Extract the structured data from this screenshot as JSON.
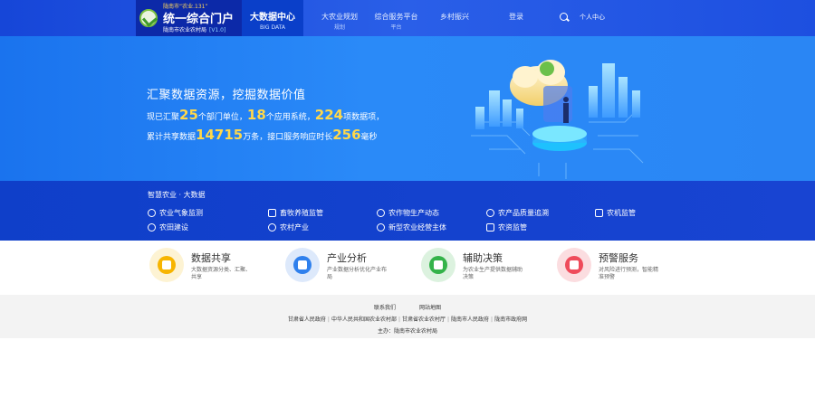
{
  "header": {
    "brand_top": "陇南市“农业.131”",
    "brand_title": "统一综合门户",
    "brand_sub": "陇南市农业农村局",
    "brand_ver": "[V1.0]",
    "active_nav": {
      "label": "大数据中心",
      "sub": "BIG DATA"
    },
    "nav": [
      {
        "label": "大农业规划",
        "sub": "规划"
      },
      {
        "label": "综合服务平台",
        "sub": "平台"
      },
      {
        "label": "乡村振兴",
        "sub": ""
      },
      {
        "label": "登录",
        "sub": ""
      }
    ],
    "login": "个人中心"
  },
  "hero": {
    "title": "汇聚数据资源，挖掘数据价值",
    "line1": {
      "pre": "现已汇聚",
      "n1": "25",
      "mid1": "个部门单位，",
      "n2": "18",
      "mid2": "个应用系统，",
      "n3": "224",
      "post": "项数据项，"
    },
    "line2": {
      "pre": "累计共享数据",
      "n1": "14715",
      "mid1": "万条，接口服务响应时长",
      "n2": "256",
      "post": "毫秒"
    }
  },
  "quick_links": {
    "heading": "智慧农业 · 大数据",
    "items": [
      "农业气象监测",
      "畜牧养殖监管",
      "农作物生产动态",
      "农产品质量追溯",
      "农机监管",
      "农田建设",
      "农村产业",
      "新型农业经营主体",
      "农资监管"
    ]
  },
  "services": [
    {
      "title": "数据共享",
      "desc": "大数据资源分类、汇聚、共享",
      "color": "#f7b500",
      "bg": "#fdf3d3"
    },
    {
      "title": "产业分析",
      "desc": "产业数据分析优化产业布局",
      "color": "#2f80ed",
      "bg": "#dde9fb"
    },
    {
      "title": "辅助决策",
      "desc": "为农业生产提供数据辅助决策",
      "color": "#34b34a",
      "bg": "#dcf2df"
    },
    {
      "title": "预警服务",
      "desc": "对风险进行预测，智能精准预警",
      "color": "#ef4b5b",
      "bg": "#fbdde0"
    }
  ],
  "footer": {
    "links": [
      "联系我们",
      "网站地图"
    ],
    "partners": [
      "甘肃省人民政府",
      "中华人民共和国农业农村部",
      "甘肃省农业农村厅",
      "陇南市人民政府",
      "陇南市政府网"
    ],
    "host": "主办：陇南市农业农村局"
  }
}
